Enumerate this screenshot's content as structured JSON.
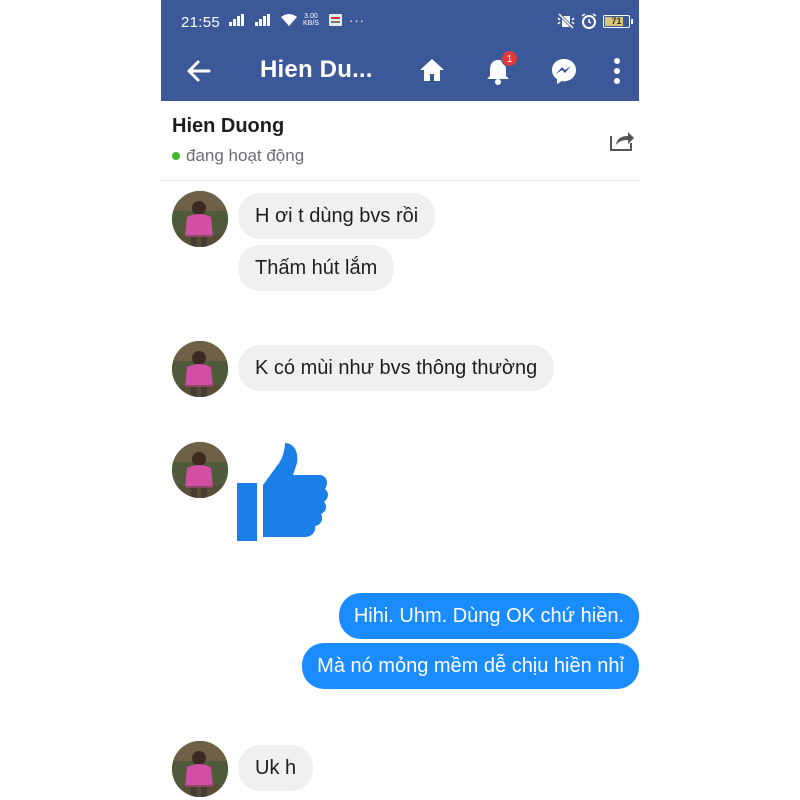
{
  "status_bar": {
    "time": "21:55",
    "net_speed_value": "3.00",
    "net_speed_unit": "KB/S",
    "overflow": "···",
    "battery": "71",
    "battery_level": 0.71,
    "icons": [
      "signal-icon",
      "signal-icon",
      "wifi-icon",
      "notification-icon",
      "mute-icon",
      "alarm-icon",
      "battery-icon"
    ]
  },
  "app_bar": {
    "title": "Hien Du...",
    "notification_count": "1",
    "colors": {
      "bar": "#3b5998",
      "badge": "#e0393e"
    },
    "icons": [
      "back-arrow-icon",
      "home-icon",
      "bell-icon",
      "messenger-icon",
      "more-vertical-icon"
    ]
  },
  "conversation": {
    "contact_name": "Hien Duong",
    "presence": "đang hoạt động",
    "share_icon": "share-icon"
  },
  "messages": [
    {
      "side": "in",
      "text": "H ơi t dùng bvs rồi"
    },
    {
      "side": "in",
      "text": "Thấm hút lắm"
    },
    {
      "side": "in",
      "text": "K có mùi như bvs thông thường"
    },
    {
      "side": "in",
      "sticker": "thumbs-up-icon"
    },
    {
      "side": "out",
      "text": "Hihi. Uhm. Dùng OK chứ hiền."
    },
    {
      "side": "out",
      "text": "Mà nó mỏng mềm dễ chịu hiền nhỉ"
    },
    {
      "side": "in",
      "text": "Uk h"
    }
  ],
  "colors": {
    "incoming_bubble": "#f1f0f0",
    "outgoing_bubble": "#1a8cff",
    "like": "#1a7fe6"
  }
}
